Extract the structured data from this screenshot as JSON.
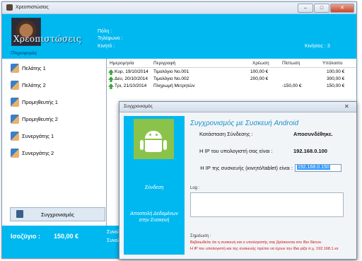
{
  "window": {
    "title": "Χρεοπιστώσεις",
    "controls": {
      "minimize": "–",
      "maximize": "□",
      "close": "✕"
    }
  },
  "header": {
    "logo_text": "Χρεοπιστώσεις",
    "info_link": "Πληροφορίες",
    "fields": {
      "city": "Πόλη :",
      "phone": "Τηλέφωνο :",
      "mobile": "Κινητό :"
    },
    "movements": "Κινήσεις : 3"
  },
  "sidebar": {
    "items": [
      {
        "label": "Πελάτης 1",
        "icon": "person-icon"
      },
      {
        "label": "Πελάτης 2",
        "icon": "person-icon"
      },
      {
        "label": "Προμηθευτής 1",
        "icon": "person-icon"
      },
      {
        "label": "Προμηθευτής 2",
        "icon": "person-icon"
      },
      {
        "label": "Συνεργάτης 1",
        "icon": "person-icon"
      },
      {
        "label": "Συνεργάτης 2",
        "icon": "person-icon"
      }
    ],
    "sync_button": "Συγχρονισμός"
  },
  "table": {
    "columns": [
      "Ημερομηνία",
      "Περιγραφή",
      "Χρέωση",
      "Πίστωση",
      "Υπόλοιπο"
    ],
    "rows": [
      {
        "date": "Κυρ, 19/10/2014",
        "description": "Τιμολόγιο No.001",
        "debit": "100,00 €",
        "credit": "",
        "balance": "100,00 €"
      },
      {
        "date": "Δευ, 20/10/2014",
        "description": "Τιμολόγιο No.002",
        "debit": "200,00 €",
        "credit": "",
        "balance": "300,00 €"
      },
      {
        "date": "Τρι, 21/10/2014",
        "description": "Πληρωμή Μετρητών",
        "debit": "",
        "credit": "-150,00 €",
        "balance": "150,00 €"
      }
    ]
  },
  "footer": {
    "balance_label": "Ισοζύγιο :",
    "balance_value": "150,00 €",
    "partial_1": "Συνολ",
    "partial_2": "Συνολ"
  },
  "dialog": {
    "title": "Συγχρονισμός",
    "close": "✕",
    "heading": "Συγχρονισμός με Συσκευή Android",
    "connect_link": "Σύνδεση",
    "send_link_1": "Αποστολή Δεδομένων",
    "send_link_2": "στην Συσκευή",
    "status_label": "Κατάσταση Σύνδεσης :",
    "status_value": "Αποσυνδέθηκε.",
    "pc_ip_label": "Η IP του υπολογιστή σας είναι :",
    "pc_ip_value": "192.168.0.100",
    "device_ip_label": "Η IP της συσκευής (κινητό/tablet) είναι :",
    "device_ip_value": "192.168.0.150",
    "log_label": "Log :",
    "notes_label": "Σημείωση :",
    "note_1": "Βεβαιωθείτε ότι η συσκευή και ο υπολογιστής σας βρίσκονται στο ίδιο δίκτυο.",
    "note_2": "Η IP του υπολογιστή και της συσκευής πρέπει να έχουν την ίδια ρίζα π.χ. 192.168.1.xx"
  },
  "colors": {
    "accent": "#00b8f0",
    "android_green": "#8bc34a",
    "heading_blue": "#1a8fc8",
    "note_red": "#d01010"
  }
}
